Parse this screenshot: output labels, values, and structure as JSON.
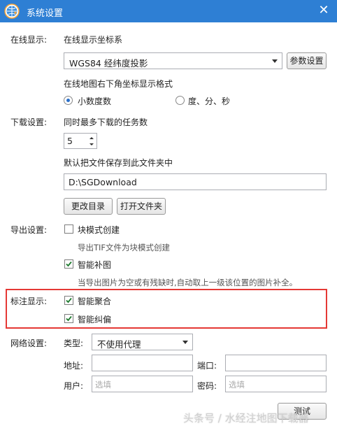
{
  "window": {
    "title": "系统设置",
    "close_glyph": "✕"
  },
  "online": {
    "section_label": "在线显示:",
    "coord_label": "在线显示坐标系",
    "coord_selected": "WGS84 经纬度投影",
    "param_button": "参数设置",
    "format_label": "在线地图右下角坐标显示格式",
    "format_options": [
      {
        "label": "小数度数",
        "selected": true
      },
      {
        "label": "度、分、秒",
        "selected": false
      }
    ]
  },
  "download": {
    "section_label": "下载设置:",
    "max_tasks_label": "同时最多下载的任务数",
    "max_tasks_value": "5",
    "folder_label": "默认把文件保存到此文件夹中",
    "folder_value": "D:\\SGDownload",
    "change_dir_button": "更改目录",
    "open_folder_button": "打开文件夹"
  },
  "export": {
    "section_label": "导出设置:",
    "block_mode": {
      "label": "块模式创建",
      "checked": false,
      "hint": "导出TIF文件为块模式创建"
    },
    "smart_fill": {
      "label": "智能补图",
      "checked": true,
      "hint": "当导出图片为空或有残缺时,自动取上一级该位置的图片补全。"
    }
  },
  "annotation": {
    "section_label": "标注显示:",
    "smart_merge": {
      "label": "智能聚合",
      "checked": true
    },
    "smart_correct": {
      "label": "智能纠偏",
      "checked": true
    }
  },
  "network": {
    "section_label": "网络设置:",
    "type_label": "类型:",
    "type_selected": "不使用代理",
    "address_label": "地址:",
    "port_label": "端口:",
    "user_label": "用户:",
    "user_placeholder": "选填",
    "password_label": "密码:",
    "password_placeholder": "选填",
    "test_button": "测试"
  },
  "watermark": "头条号 / 水经注地图下载器",
  "colors": {
    "titlebar": "#2e7fd4",
    "highlight": "#e53935",
    "accent": "#2a6fc9"
  }
}
